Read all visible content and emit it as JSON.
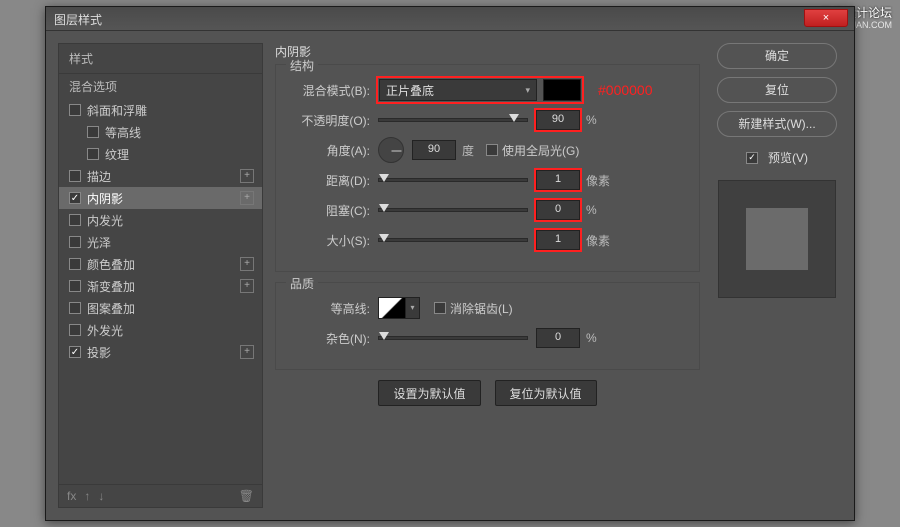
{
  "watermark": "思缘设计论坛",
  "watermark_url": "WWW.MISSYUAN.COM",
  "window": {
    "title": "图层样式",
    "close": "×"
  },
  "sidebar": {
    "header": "样式",
    "sub": "混合选项",
    "items": [
      {
        "label": "斜面和浮雕",
        "checked": false,
        "plus": false,
        "indent": false
      },
      {
        "label": "等高线",
        "checked": false,
        "plus": false,
        "indent": true
      },
      {
        "label": "纹理",
        "checked": false,
        "plus": false,
        "indent": true
      },
      {
        "label": "描边",
        "checked": false,
        "plus": true,
        "indent": false
      },
      {
        "label": "内阴影",
        "checked": true,
        "plus": true,
        "indent": false,
        "selected": true
      },
      {
        "label": "内发光",
        "checked": false,
        "plus": false,
        "indent": false
      },
      {
        "label": "光泽",
        "checked": false,
        "plus": false,
        "indent": false
      },
      {
        "label": "颜色叠加",
        "checked": false,
        "plus": true,
        "indent": false
      },
      {
        "label": "渐变叠加",
        "checked": false,
        "plus": true,
        "indent": false
      },
      {
        "label": "图案叠加",
        "checked": false,
        "plus": false,
        "indent": false
      },
      {
        "label": "外发光",
        "checked": false,
        "plus": false,
        "indent": false
      },
      {
        "label": "投影",
        "checked": true,
        "plus": true,
        "indent": false
      }
    ],
    "fx": "fx"
  },
  "panel": {
    "title": "内阴影",
    "structure": {
      "legend": "结构",
      "blend_label": "混合模式(B):",
      "blend_value": "正片叠底",
      "color_annot": "#000000",
      "opacity_label": "不透明度(O):",
      "opacity_value": "90",
      "opacity_unit": "%",
      "angle_label": "角度(A):",
      "angle_value": "90",
      "angle_unit": "度",
      "global_light": "使用全局光(G)",
      "distance_label": "距离(D):",
      "distance_value": "1",
      "distance_unit": "像素",
      "choke_label": "阻塞(C):",
      "choke_value": "0",
      "choke_unit": "%",
      "size_label": "大小(S):",
      "size_value": "1",
      "size_unit": "像素"
    },
    "quality": {
      "legend": "品质",
      "contour_label": "等高线:",
      "antialias": "消除锯齿(L)",
      "noise_label": "杂色(N):",
      "noise_value": "0",
      "noise_unit": "%"
    },
    "buttons": {
      "default": "设置为默认值",
      "reset": "复位为默认值"
    }
  },
  "right": {
    "ok": "确定",
    "cancel": "复位",
    "newstyle": "新建样式(W)...",
    "preview": "预览(V)"
  }
}
